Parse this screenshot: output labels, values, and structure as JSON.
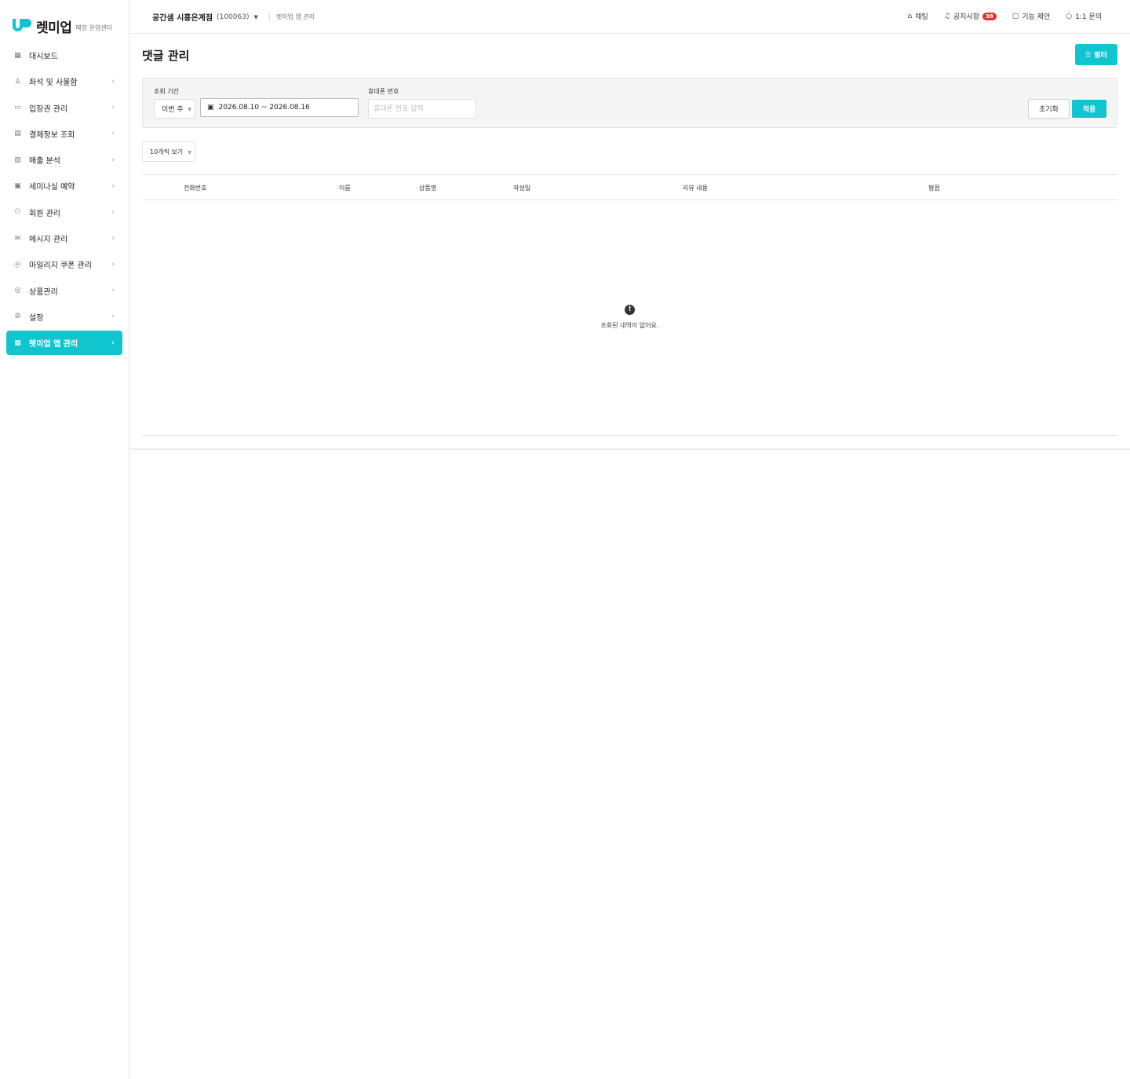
{
  "brand": {
    "name": "렛미업",
    "subtitle": "매장 운영센터",
    "accent": "#11c5cf"
  },
  "sidebar": {
    "items": [
      {
        "label": "대시보드",
        "icon": "grid-icon",
        "glyph": "▦",
        "chevron": ""
      },
      {
        "label": "좌석 및 사물함",
        "icon": "seat-icon",
        "glyph": "♙",
        "chevron": "›"
      },
      {
        "label": "입장권 관리",
        "icon": "ticket-icon",
        "glyph": "▭",
        "chevron": "›"
      },
      {
        "label": "결제정보 조회",
        "icon": "card-icon",
        "glyph": "▤",
        "chevron": "›"
      },
      {
        "label": "매출 분석",
        "icon": "bar-chart-icon",
        "glyph": "▥",
        "chevron": "›"
      },
      {
        "label": "세미나실 예약",
        "icon": "calendar-icon",
        "glyph": "▣",
        "chevron": "›"
      },
      {
        "label": "회원 관리",
        "icon": "users-icon",
        "glyph": "⚇",
        "chevron": "›"
      },
      {
        "label": "메시지 관리",
        "icon": "mail-icon",
        "glyph": "✉",
        "chevron": "›"
      },
      {
        "label": "마일리지 쿠폰 관리",
        "icon": "coin-icon",
        "glyph": "ⓟ",
        "chevron": "›"
      },
      {
        "label": "상품관리",
        "icon": "bag-icon",
        "glyph": "◎",
        "chevron": "›"
      },
      {
        "label": "설정",
        "icon": "gear-icon",
        "glyph": "⚙",
        "chevron": "›"
      },
      {
        "label": "렛미업 앱 관리",
        "icon": "app-grid-icon",
        "glyph": "▦",
        "chevron": "›",
        "active": true
      }
    ]
  },
  "header": {
    "store_name": "공간샘 시흥은계점",
    "store_code": "(100063)",
    "breadcrumb": "렛미업 앱 관리",
    "links": {
      "chat": "채팅",
      "notice": "공지사항",
      "notice_count": "38",
      "suggest": "기능 제안",
      "inquiry": "1:1 문의"
    }
  },
  "main": {
    "title": "댓글 관리",
    "filter_button": "필터",
    "filters": {
      "period_label": "조회 기간",
      "period_value": "이번 주",
      "date_range": "2026.08.10 ~ 2026.08.16",
      "phone_label": "휴대폰 번호",
      "phone_placeholder": "휴대폰 번호 입력",
      "reset": "초기화",
      "apply": "적용"
    },
    "page_size": "10개씩 보기",
    "table": {
      "columns": [
        "전화번호",
        "이름",
        "상품명",
        "작성일",
        "리뷰 내용",
        "평점"
      ],
      "rows": []
    },
    "empty_message": "조회된 내역이 없어요."
  }
}
